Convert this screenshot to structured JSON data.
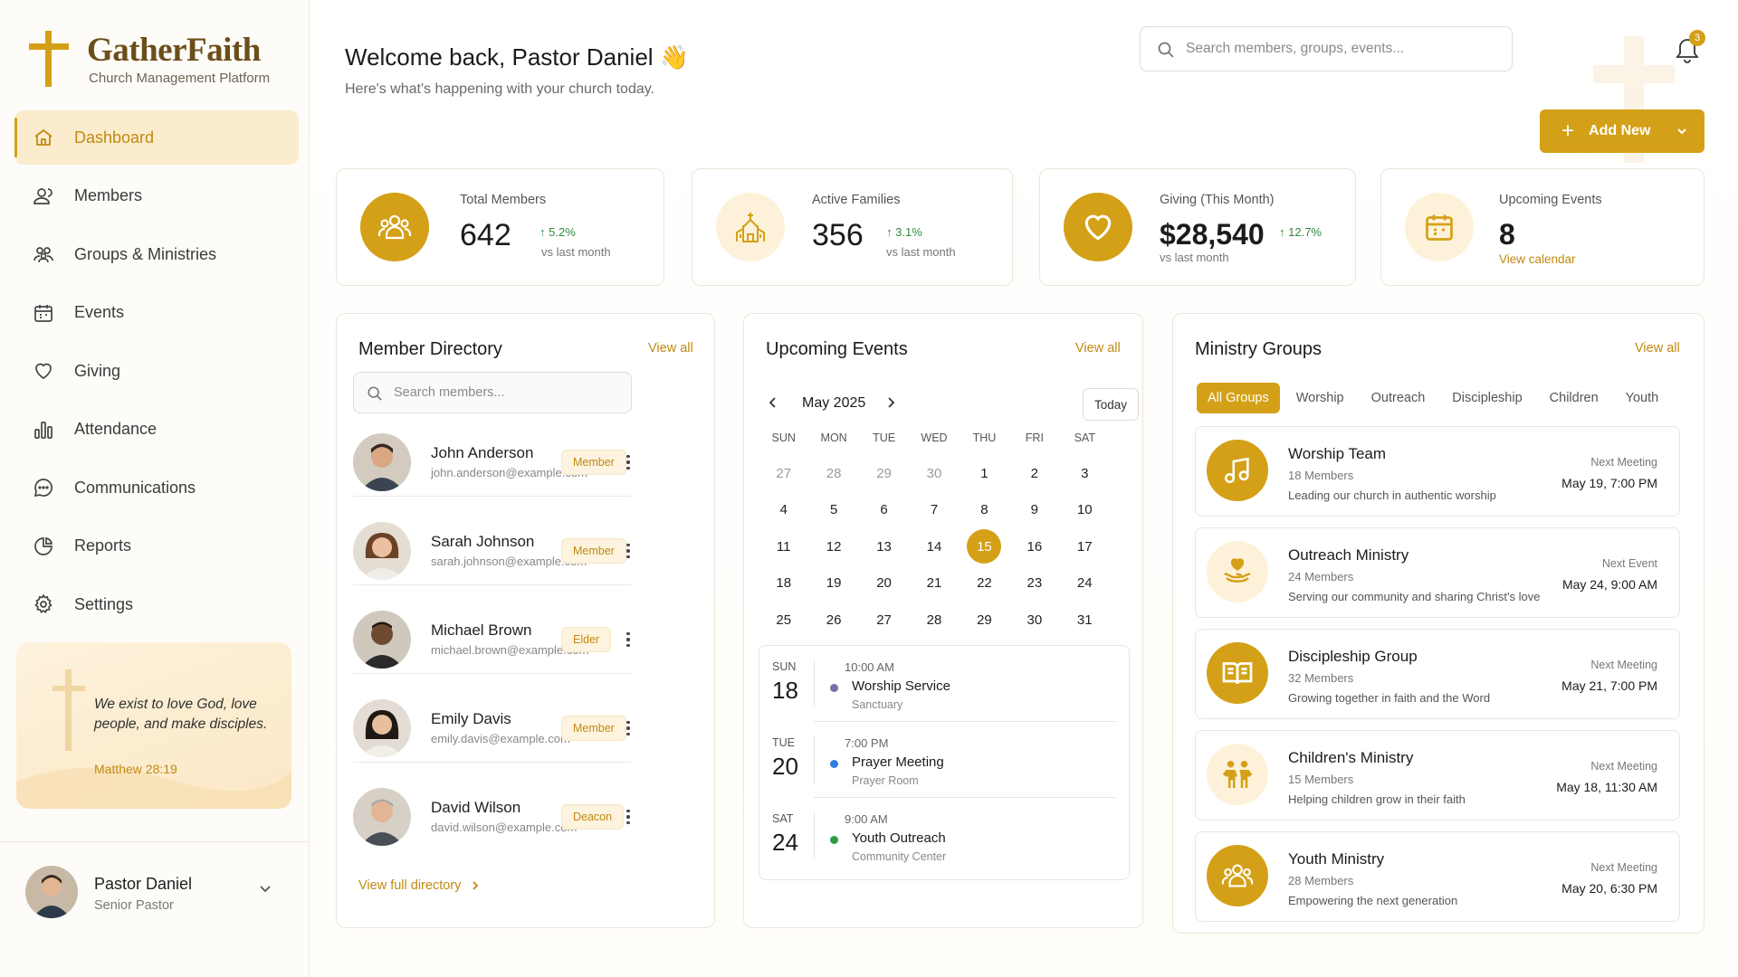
{
  "brand": {
    "name": "GatherFaith",
    "tagline": "Church Management Platform",
    "accent": "#d4a017"
  },
  "nav": [
    {
      "label": "Dashboard",
      "icon": "home-icon",
      "active": true
    },
    {
      "label": "Members",
      "icon": "user-icon"
    },
    {
      "label": "Groups & Ministries",
      "icon": "users-icon"
    },
    {
      "label": "Events",
      "icon": "calendar-icon"
    },
    {
      "label": "Giving",
      "icon": "heart-icon"
    },
    {
      "label": "Attendance",
      "icon": "bar-chart-icon"
    },
    {
      "label": "Communications",
      "icon": "chat-icon"
    },
    {
      "label": "Reports",
      "icon": "pie-chart-icon"
    },
    {
      "label": "Settings",
      "icon": "gear-icon"
    }
  ],
  "verse": {
    "text": "We exist to love God, love people, and make disciples.",
    "ref": "Matthew 28:19"
  },
  "profile": {
    "name": "Pastor Daniel",
    "role": "Senior Pastor"
  },
  "header": {
    "welcome": "Welcome back, Pastor Daniel 👋",
    "subtitle": "Here's what's happening with your church today.",
    "search_placeholder": "Search members, groups, events...",
    "notifications": "3",
    "add_new": "Add New"
  },
  "stats": [
    {
      "title": "Total Members",
      "value": "642",
      "change": "5.2%",
      "sub": "vs last month"
    },
    {
      "title": "Active Families",
      "value": "356",
      "change": "3.1%",
      "sub": "vs last month"
    },
    {
      "title": "Giving (This Month)",
      "value": "$28,540",
      "change": "12.7%",
      "sub": "vs last month"
    },
    {
      "title": "Upcoming Events",
      "value": "8",
      "link": "View calendar"
    }
  ],
  "directory": {
    "title": "Member Directory",
    "view_all": "View all",
    "search_placeholder": "Search members...",
    "members": [
      {
        "name": "John Anderson",
        "email": "john.anderson@example.com",
        "role": "Member"
      },
      {
        "name": "Sarah Johnson",
        "email": "sarah.johnson@example.com",
        "role": "Member"
      },
      {
        "name": "Michael Brown",
        "email": "michael.brown@example.com",
        "role": "Elder"
      },
      {
        "name": "Emily Davis",
        "email": "emily.davis@example.com",
        "role": "Member"
      },
      {
        "name": "David Wilson",
        "email": "david.wilson@example.com",
        "role": "Deacon"
      }
    ],
    "full_link": "View full directory"
  },
  "events": {
    "title": "Upcoming Events",
    "view_all": "View all",
    "month": "May 2025",
    "today": "Today",
    "dow": [
      "SUN",
      "MON",
      "TUE",
      "WED",
      "THU",
      "FRI",
      "SAT"
    ],
    "days": [
      "27",
      "28",
      "29",
      "30",
      "1",
      "2",
      "3",
      "4",
      "5",
      "6",
      "7",
      "8",
      "9",
      "10",
      "11",
      "12",
      "13",
      "14",
      "15",
      "16",
      "17",
      "18",
      "19",
      "20",
      "21",
      "22",
      "23",
      "24",
      "25",
      "26",
      "27",
      "28",
      "29",
      "30",
      "31"
    ],
    "muted_count": 4,
    "selected_day": "15",
    "list": [
      {
        "dow": "SUN",
        "day": "18",
        "time": "10:00 AM",
        "title": "Worship Service",
        "location": "Sanctuary",
        "color": "#7b6fb0"
      },
      {
        "dow": "TUE",
        "day": "20",
        "time": "7:00 PM",
        "title": "Prayer Meeting",
        "location": "Prayer Room",
        "color": "#2f7de1"
      },
      {
        "dow": "SAT",
        "day": "24",
        "time": "9:00 AM",
        "title": "Youth Outreach",
        "location": "Community Center",
        "color": "#2e9a48"
      }
    ]
  },
  "ministry": {
    "title": "Ministry Groups",
    "view_all": "View all",
    "tabs": [
      "All Groups",
      "Worship",
      "Outreach",
      "Discipleship",
      "Children",
      "Youth"
    ],
    "groups": [
      {
        "name": "Worship Team",
        "members": "18 Members",
        "desc": "Leading our church in authentic worship",
        "next_label": "Next Meeting",
        "next": "May 19, 7:00 PM",
        "icon": "music-icon"
      },
      {
        "name": "Outreach Ministry",
        "members": "24 Members",
        "desc": "Serving our community and sharing Christ's love",
        "next_label": "Next Event",
        "next": "May 24, 9:00 AM",
        "icon": "hands-heart-icon"
      },
      {
        "name": "Discipleship Group",
        "members": "32 Members",
        "desc": "Growing together in faith and the Word",
        "next_label": "Next Meeting",
        "next": "May 21, 7:00 PM",
        "icon": "book-icon"
      },
      {
        "name": "Children's Ministry",
        "members": "15 Members",
        "desc": "Helping children grow in their faith",
        "next_label": "Next Meeting",
        "next": "May 18, 11:30 AM",
        "icon": "children-icon"
      },
      {
        "name": "Youth Ministry",
        "members": "28 Members",
        "desc": "Empowering the next generation",
        "next_label": "Next Meeting",
        "next": "May 20, 6:30 PM",
        "icon": "group-icon"
      }
    ]
  }
}
